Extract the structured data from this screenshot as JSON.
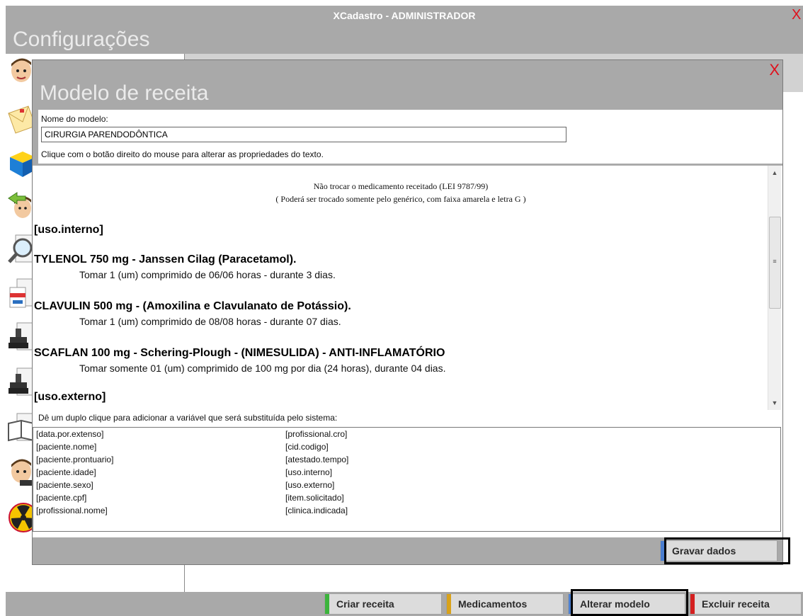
{
  "window": {
    "title": "XCadastro - ADMINISTRADOR",
    "close_glyph": "X",
    "header": "Configurações"
  },
  "modal": {
    "title": "Modelo de receita",
    "close_glyph": "X",
    "name_label": "Nome do modelo:",
    "name_value": "CIRURGIA PARENDODÔNTICA",
    "hint": "Clique com o botão direito do mouse para alterar as propriedades do texto.",
    "editor": {
      "notice1": "Não trocar o medicamento receitado (LEI 9787/99)",
      "notice2": "( Poderá ser trocado somente pelo genérico, com faixa amarela e letra G )",
      "section_internal": "[uso.interno]",
      "items": [
        {
          "title": "TYLENOL 750 mg -  Janssen Cilag (Paracetamol).",
          "instruction": "Tomar 1 (um) comprimido de 06/06 horas - durante 3 dias."
        },
        {
          "title": "CLAVULIN 500 mg -  (Amoxilina e Clavulanato de Potássio).",
          "instruction": "Tomar 1 (um) comprimido de 08/08 horas - durante 07 dias."
        },
        {
          "title": "SCAFLAN 100 mg - Schering-Plough - (NIMESULIDA) - ANTI-INFLAMATÓRIO",
          "instruction": "Tomar somente 01 (um) comprimido de 100 mg por dia (24 horas), durante 04 dias."
        }
      ],
      "section_external": "[uso.externo]"
    },
    "variables_hint": "Dê um duplo clique para adicionar a variável que será substituída pelo sistema:",
    "variables_left": [
      "[data.por.extenso]",
      "[paciente.nome]",
      "[paciente.prontuario]",
      "[paciente.idade]",
      "[paciente.sexo]",
      "[paciente.cpf]",
      "[profissional.nome]"
    ],
    "variables_right": [
      "[profissional.cro]",
      "[cid.codigo]",
      "[atestado.tempo]",
      "[uso.interno]",
      "[uso.externo]",
      "[item.solicitado]",
      "[clinica.indicada]"
    ],
    "save_button": "Gravar dados"
  },
  "bottom_buttons": [
    {
      "label": "Criar receita",
      "color": "#3cb43c"
    },
    {
      "label": "Medicamentos",
      "color": "#d9a21a"
    },
    {
      "label": "Alterar modelo",
      "color": "#4a7ed0"
    },
    {
      "label": "Excluir receita",
      "color": "#d42020"
    }
  ],
  "sidebar_icons": [
    "avatar-man-icon",
    "letter-envelope-icon",
    "blue-cube-icon",
    "avatar-back-arrow-icon",
    "magnifier-icon",
    "medicine-box-icon",
    "stamp-icon",
    "stamp-icon-2",
    "book-icon",
    "avatar-man-icon-2",
    "radiation-icon"
  ],
  "colors": {
    "chrome": "#a9a9a9",
    "close": "#e0101c",
    "save_stripe": "#4a7ed0"
  }
}
